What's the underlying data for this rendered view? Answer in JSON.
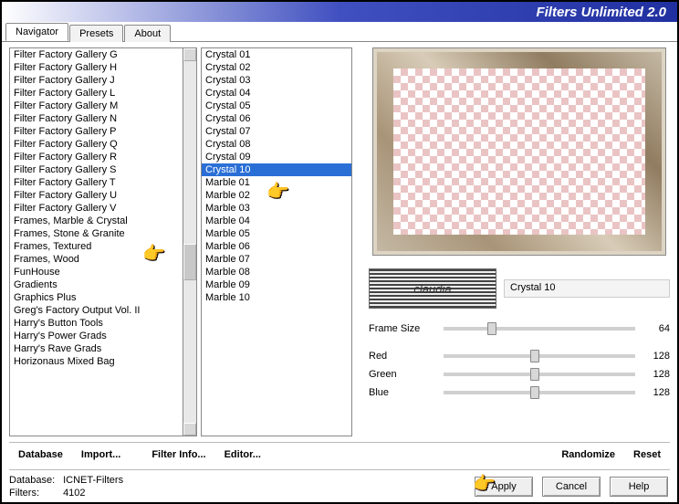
{
  "app_title": "Filters Unlimited 2.0",
  "tabs": [
    {
      "label": "Navigator",
      "active": true
    },
    {
      "label": "Presets",
      "active": false
    },
    {
      "label": "About",
      "active": false
    }
  ],
  "categories": [
    "Filter Factory Gallery G",
    "Filter Factory Gallery H",
    "Filter Factory Gallery J",
    "Filter Factory Gallery L",
    "Filter Factory Gallery M",
    "Filter Factory Gallery N",
    "Filter Factory Gallery P",
    "Filter Factory Gallery Q",
    "Filter Factory Gallery R",
    "Filter Factory Gallery S",
    "Filter Factory Gallery T",
    "Filter Factory Gallery U",
    "Filter Factory Gallery V",
    "Frames, Marble & Crystal",
    "Frames, Stone & Granite",
    "Frames, Textured",
    "Frames, Wood",
    "FunHouse",
    "Gradients",
    "Graphics Plus",
    "Greg's Factory Output Vol. II",
    "Harry's Button Tools",
    "Harry's Power Grads",
    "Harry's Rave Grads",
    "Horizonaus Mixed Bag"
  ],
  "selected_category_index": 13,
  "filters": [
    "Crystal 01",
    "Crystal 02",
    "Crystal 03",
    "Crystal 04",
    "Crystal 05",
    "Crystal 06",
    "Crystal 07",
    "Crystal 08",
    "Crystal 09",
    "Crystal 10",
    "Marble 01",
    "Marble 02",
    "Marble 03",
    "Marble 04",
    "Marble 05",
    "Marble 06",
    "Marble 07",
    "Marble 08",
    "Marble 09",
    "Marble 10"
  ],
  "selected_filter_index": 9,
  "current_filter_name": "Crystal 10",
  "logo_text": "claudia",
  "sliders": {
    "frame_size": {
      "label": "Frame Size",
      "value": 64,
      "max": 255
    },
    "red": {
      "label": "Red",
      "value": 128,
      "max": 255
    },
    "green": {
      "label": "Green",
      "value": 128,
      "max": 255
    },
    "blue": {
      "label": "Blue",
      "value": 128,
      "max": 255
    }
  },
  "toolbar": {
    "database": "Database",
    "import": "Import...",
    "filter_info": "Filter Info...",
    "editor": "Editor...",
    "randomize": "Randomize",
    "reset": "Reset"
  },
  "status": {
    "db_label": "Database:",
    "db_value": "ICNET-Filters",
    "filters_label": "Filters:",
    "filters_value": "4102"
  },
  "buttons": {
    "apply": "Apply",
    "cancel": "Cancel",
    "help": "Help"
  },
  "pointer_glyph": "👉"
}
